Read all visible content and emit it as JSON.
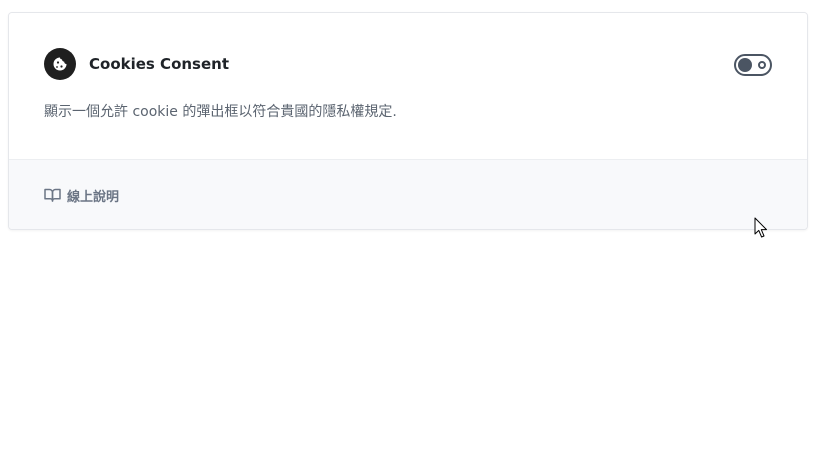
{
  "extension": {
    "icon": "cookie-icon",
    "title": "Cookies Consent",
    "description": "顯示一個允許 cookie 的彈出框以符合貴國的隱私權規定.",
    "enabled": false
  },
  "footer": {
    "help_icon": "book-open-icon",
    "help_label": "線上說明"
  },
  "colors": {
    "icon_bg": "#1f1f1f",
    "toggle": "#4b5563",
    "footer_bg": "#f8f9fb",
    "muted_text": "#6b7585"
  }
}
